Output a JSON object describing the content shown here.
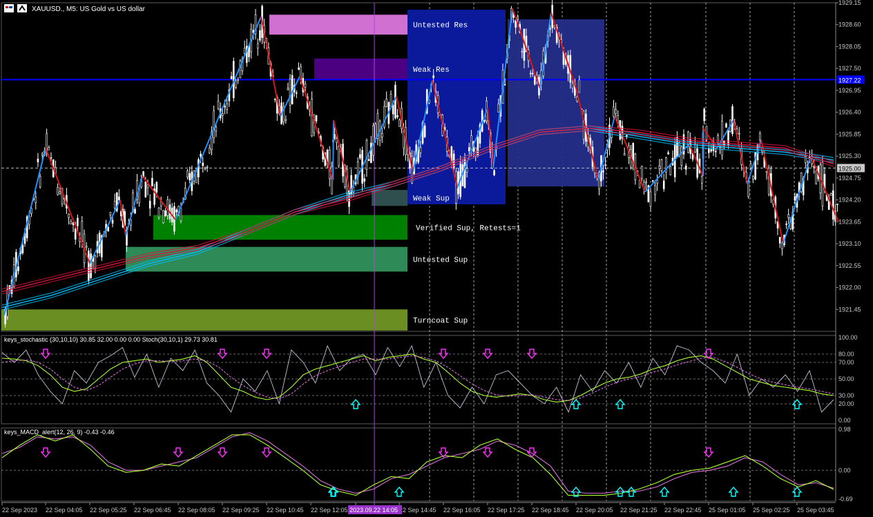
{
  "window": {
    "title": "XAUUSD., M5:  US Gold vs US dollar",
    "icon_name": "chart-window-icon",
    "active_button": "chart-mode-icon"
  },
  "chart_data": [
    {
      "type": "candlestick",
      "title": "XAUUSD., M5:  US Gold vs US dollar",
      "ylim": [
        1920.9,
        1929.15
      ],
      "y_ticks": [
        "1929.15",
        "1928.60",
        "1928.05",
        "1927.50",
        "1926.95",
        "1926.40",
        "1925.85",
        "1925.30",
        "1924.75",
        "1924.20",
        "1923.65",
        "1923.10",
        "1922.55",
        "1922.00",
        "1921.45"
      ],
      "x_ticks": [
        "22 Sep 2023",
        "22 Sep 04:05",
        "22 Sep 05:25",
        "22 Sep 06:45",
        "22 Sep 08:05",
        "22 Sep 09:25",
        "22 Sep 10:45",
        "22 Sep 12:05",
        "22 Sep 14:05",
        "22 Sep 14:45",
        "22 Sep 16:05",
        "22 Sep 17:25",
        "22 Sep 18:45",
        "22 Sep 20:05",
        "22 Sep 21:25",
        "22 Sep 22:45",
        "25 Sep 01:05",
        "25 Sep 02:25",
        "25 Sep 03:45"
      ],
      "crosshair_time": "2023.09.22 14:05",
      "current_price": "1925.00",
      "blue_line_price": "1927.22",
      "zones": [
        {
          "label": "Untested Res",
          "from": 1928.35,
          "to": 1928.85,
          "color": "#d070d0"
        },
        {
          "label": "Weak Res",
          "from": 1927.22,
          "to": 1927.75,
          "color": "#4b0082"
        },
        {
          "label": "Weak Sup",
          "from": 1924.05,
          "to": 1924.45,
          "color": "#2f4f4f"
        },
        {
          "label": "Verified Sup, Retests=1",
          "from": 1923.2,
          "to": 1923.82,
          "color": "#008000"
        },
        {
          "label": "Untested Sup",
          "from": 1922.4,
          "to": 1923.02,
          "color": "#2e8b57"
        },
        {
          "label": "Turncoat Sup",
          "from": 1920.92,
          "to": 1921.45,
          "color": "#6b8e23"
        }
      ],
      "zigzag_pivots": [
        {
          "t": "22 Sep 2023",
          "price": 1921.3
        },
        {
          "t": "22 Sep 04:05",
          "price": 1925.5
        },
        {
          "t": "22 Sep 05:25",
          "price": 1922.6
        },
        {
          "t": "22 Sep 06:20",
          "price": 1924.2
        },
        {
          "t": "22 Sep 06:30",
          "price": 1923.3
        },
        {
          "t": "22 Sep 07:00",
          "price": 1924.8
        },
        {
          "t": "22 Sep 08:00",
          "price": 1923.7
        },
        {
          "t": "22 Sep 10:35",
          "price": 1928.8
        },
        {
          "t": "22 Sep 11:10",
          "price": 1926.3
        },
        {
          "t": "22 Sep 11:45",
          "price": 1927.3
        },
        {
          "t": "22 Sep 12:45",
          "price": 1924.7
        },
        {
          "t": "22 Sep 13:25",
          "price": 1926.2
        },
        {
          "t": "22 Sep 13:55",
          "price": 1924.4
        },
        {
          "t": "22 Sep 14:40",
          "price": 1926.8
        },
        {
          "t": "22 Sep 15:10",
          "price": 1924.9
        },
        {
          "t": "22 Sep 15:45",
          "price": 1927.2
        },
        {
          "t": "22 Sep 16:30",
          "price": 1924.5
        },
        {
          "t": "22 Sep 17:25",
          "price": 1926.5
        },
        {
          "t": "22 Sep 17:35",
          "price": 1925.0
        },
        {
          "t": "22 Sep 18:10",
          "price": 1929.0
        },
        {
          "t": "22 Sep 19:00",
          "price": 1927.0
        },
        {
          "t": "22 Sep 19:20",
          "price": 1928.9
        },
        {
          "t": "22 Sep 20:05",
          "price": 1927.0
        },
        {
          "t": "22 Sep 20:45",
          "price": 1924.7
        },
        {
          "t": "22 Sep 21:15",
          "price": 1926.3
        },
        {
          "t": "22 Sep 22:10",
          "price": 1924.4
        },
        {
          "t": "22 Sep 23:30",
          "price": 1925.6
        },
        {
          "t": "22 Sep 23:55",
          "price": 1924.8
        },
        {
          "t": "25 Sep 00:55",
          "price": 1926.0
        },
        {
          "t": "25 Sep 01:20",
          "price": 1925.5
        },
        {
          "t": "25 Sep 01:50",
          "price": 1926.2
        },
        {
          "t": "25 Sep 02:15",
          "price": 1924.6
        },
        {
          "t": "25 Sep 02:40",
          "price": 1925.7
        },
        {
          "t": "25 Sep 03:20",
          "price": 1923.1
        },
        {
          "t": "25 Sep 04:10",
          "price": 1925.3
        },
        {
          "t": "25 Sep 05:00",
          "price": 1923.65
        }
      ],
      "moving_averages": [
        {
          "color": "#00bfff",
          "values": [
            1921.5,
            1921.8,
            1922.2,
            1922.6,
            1922.9,
            1923.4,
            1923.9,
            1924.3,
            1924.6,
            1925.0,
            1925.5,
            1925.9,
            1926.0,
            1925.8,
            1925.6,
            1925.5,
            1925.4,
            1925.2
          ]
        },
        {
          "color": "#dc143c",
          "values": [
            1921.9,
            1922.2,
            1922.5,
            1922.8,
            1923.0,
            1923.4,
            1923.9,
            1924.2,
            1924.6,
            1925.0,
            1925.5,
            1925.9,
            1926.0,
            1925.9,
            1925.7,
            1925.6,
            1925.5,
            1925.1
          ]
        }
      ]
    },
    {
      "type": "line",
      "title": "keys_stochastic (30,10,10) 30.85 32.00 0.00 0.00 Stoch(30,10,1) 29.73 30.81",
      "ylim": [
        0,
        100
      ],
      "y_ticks": [
        "100.00",
        "80.00",
        "70.00",
        "50.00",
        "30.00",
        "20.00",
        "0.00"
      ],
      "levels": [
        80,
        70,
        50,
        30,
        20
      ],
      "series": [
        {
          "color": "#c0c0d8",
          "values": [
            82,
            70,
            85,
            55,
            35,
            20,
            60,
            45,
            70,
            78,
            88,
            52,
            80,
            40,
            75,
            60,
            85,
            45,
            30,
            10,
            50,
            35,
            60,
            20,
            85,
            70,
            45,
            90,
            60,
            75,
            80,
            55,
            88,
            65,
            90,
            40,
            70,
            30,
            15,
            40,
            20,
            55,
            60,
            45,
            30,
            20,
            40,
            10,
            55,
            35,
            60,
            45,
            70,
            40,
            75,
            55,
            90,
            85,
            70,
            60,
            45,
            80,
            30,
            50,
            40,
            55,
            35,
            60,
            10,
            25
          ]
        },
        {
          "color": "#adff2f",
          "values": [
            75,
            74,
            72,
            66,
            55,
            40,
            35,
            38,
            50,
            62,
            70,
            72,
            74,
            70,
            72,
            74,
            78,
            70,
            55,
            40,
            35,
            28,
            25,
            28,
            40,
            55,
            62,
            66,
            70,
            74,
            78,
            72,
            76,
            78,
            80,
            74,
            70,
            58,
            45,
            35,
            30,
            28,
            30,
            32,
            30,
            25,
            22,
            24,
            30,
            38,
            45,
            50,
            52,
            56,
            62,
            66,
            72,
            76,
            78,
            74,
            66,
            58,
            50,
            46,
            42,
            40,
            38,
            36,
            32,
            30
          ]
        },
        {
          "color": "#da70d6",
          "values": [
            70,
            72,
            73,
            70,
            62,
            50,
            40,
            36,
            42,
            52,
            62,
            68,
            72,
            72,
            71,
            72,
            74,
            72,
            64,
            52,
            42,
            34,
            28,
            26,
            32,
            44,
            54,
            60,
            65,
            70,
            74,
            74,
            74,
            76,
            78,
            76,
            72,
            64,
            54,
            44,
            36,
            31,
            29,
            30,
            31,
            28,
            25,
            24,
            27,
            33,
            40,
            46,
            50,
            53,
            58,
            62,
            67,
            71,
            75,
            76,
            71,
            64,
            56,
            50,
            46,
            43,
            40,
            38,
            35,
            32
          ]
        }
      ],
      "markers": [
        {
          "kind": "down",
          "t": "22 Sep 04:05"
        },
        {
          "kind": "down",
          "t": "22 Sep 09:25"
        },
        {
          "kind": "down",
          "t": "22 Sep 10:45"
        },
        {
          "kind": "up",
          "t": "22 Sep 14:05"
        },
        {
          "kind": "down",
          "t": "22 Sep 16:05"
        },
        {
          "kind": "down",
          "t": "22 Sep 17:25"
        },
        {
          "kind": "down",
          "t": "22 Sep 18:45"
        },
        {
          "kind": "up",
          "t": "22 Sep 20:05"
        },
        {
          "kind": "up",
          "t": "22 Sep 21:25"
        },
        {
          "kind": "down",
          "t": "25 Sep 01:05"
        },
        {
          "kind": "up",
          "t": "25 Sep 03:45"
        }
      ]
    },
    {
      "type": "line",
      "title": "keys_MACD_alert(12, 26, 9) -0.43 -0.46",
      "ylim": [
        -0.69,
        0.98
      ],
      "y_ticks": [
        "0.98",
        "0.00",
        "-0.69"
      ],
      "series": [
        {
          "color": "#da70d6",
          "values": [
            0.4,
            0.55,
            0.8,
            0.75,
            0.8,
            0.6,
            0.2,
            0.0,
            0.0,
            0.1,
            0.2,
            0.3,
            0.55,
            0.8,
            0.9,
            0.7,
            0.4,
            0.1,
            -0.25,
            -0.45,
            -0.55,
            -0.45,
            -0.2,
            -0.1,
            0.1,
            0.3,
            0.4,
            0.5,
            0.7,
            0.6,
            0.4,
            0.1,
            -0.5,
            -0.55,
            -0.55,
            -0.5,
            -0.5,
            -0.4,
            -0.2,
            -0.05,
            0.0,
            0.1,
            0.3,
            0.2,
            -0.1,
            -0.35,
            -0.3,
            -0.43
          ]
        },
        {
          "color": "#adff2f",
          "values": [
            0.3,
            0.6,
            0.85,
            0.7,
            0.85,
            0.5,
            0.1,
            -0.05,
            0.0,
            0.15,
            0.1,
            0.35,
            0.6,
            0.85,
            0.85,
            0.6,
            0.3,
            0.0,
            -0.35,
            -0.5,
            -0.6,
            -0.35,
            -0.15,
            -0.2,
            0.2,
            0.35,
            0.3,
            0.6,
            0.75,
            0.5,
            0.3,
            -0.1,
            -0.6,
            -0.6,
            -0.6,
            -0.55,
            -0.45,
            -0.3,
            -0.1,
            0.0,
            0.05,
            0.2,
            0.35,
            0.1,
            -0.2,
            -0.4,
            -0.25,
            -0.46
          ]
        }
      ],
      "markers": [
        {
          "kind": "down",
          "t": "22 Sep 04:05"
        },
        {
          "kind": "down",
          "t": "22 Sep 08:05"
        },
        {
          "kind": "down",
          "t": "22 Sep 09:25"
        },
        {
          "kind": "down",
          "t": "22 Sep 10:45"
        },
        {
          "kind": "up",
          "t": "22 Sep 12:45"
        },
        {
          "kind": "up",
          "t": "22 Sep 13:25"
        },
        {
          "kind": "up",
          "t": "22 Sep 14:45"
        },
        {
          "kind": "down",
          "t": "22 Sep 16:05"
        },
        {
          "kind": "down",
          "t": "22 Sep 17:25"
        },
        {
          "kind": "down",
          "t": "22 Sep 18:45"
        },
        {
          "kind": "up",
          "t": "22 Sep 20:05"
        },
        {
          "kind": "up",
          "t": "22 Sep 21:25"
        },
        {
          "kind": "up",
          "t": "22 Sep 21:45"
        },
        {
          "kind": "up",
          "t": "22 Sep 22:45"
        },
        {
          "kind": "down",
          "t": "25 Sep 01:05"
        },
        {
          "kind": "up",
          "t": "25 Sep 01:50"
        },
        {
          "kind": "up",
          "t": "25 Sep 03:45"
        }
      ]
    }
  ]
}
